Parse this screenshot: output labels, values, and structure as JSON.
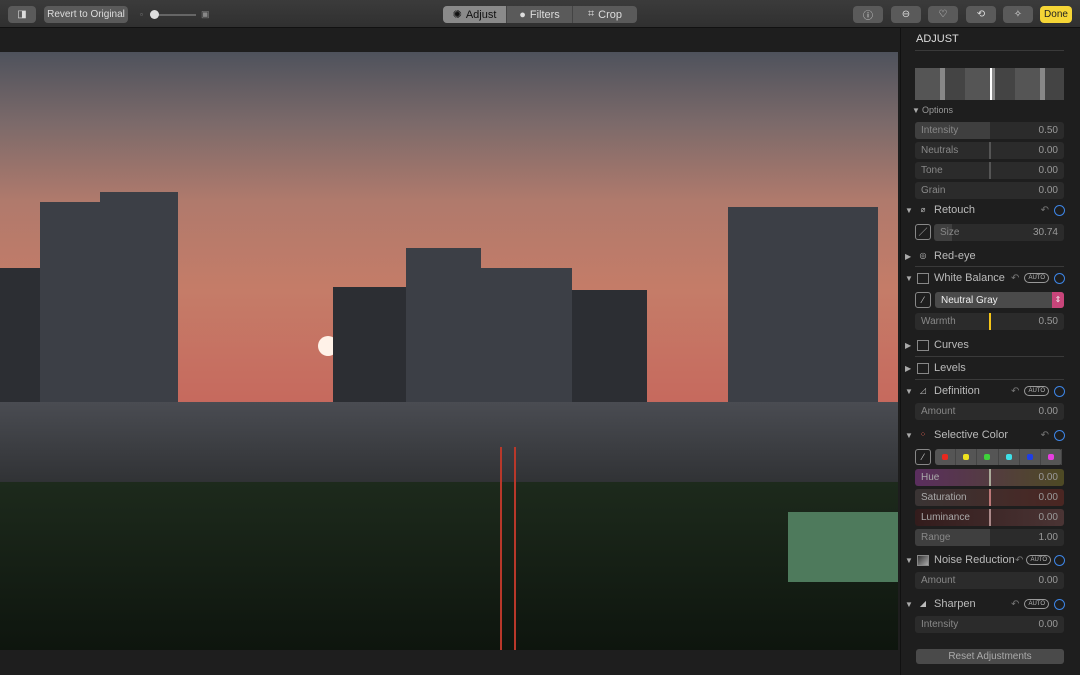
{
  "toolbar": {
    "revert": "Revert to Original",
    "tabs": [
      "Adjust",
      "Filters",
      "Crop"
    ],
    "active_tab": "Adjust",
    "done": "Done",
    "icons": [
      "info-icon",
      "more-icon",
      "heart-icon",
      "rotate-icon",
      "magic-wand-icon"
    ]
  },
  "sidebar": {
    "title": "ADJUST",
    "options_label": "Options",
    "options": [
      {
        "label": "Intensity",
        "value": "0.50",
        "fraction": 0.5
      },
      {
        "label": "Neutrals",
        "value": "0.00"
      },
      {
        "label": "Tone",
        "value": "0.00"
      },
      {
        "label": "Grain",
        "value": "0.00"
      }
    ],
    "retouch": {
      "label": "Retouch",
      "size_label": "Size",
      "size_value": "30.74"
    },
    "redeye": {
      "label": "Red-eye"
    },
    "white_balance": {
      "label": "White Balance",
      "auto": "AUTO",
      "mode": "Neutral Gray",
      "warmth_label": "Warmth",
      "warmth_value": "0.50"
    },
    "curves": {
      "label": "Curves"
    },
    "levels": {
      "label": "Levels"
    },
    "definition": {
      "label": "Definition",
      "auto": "AUTO",
      "amount_label": "Amount",
      "amount_value": "0.00"
    },
    "selective_color": {
      "label": "Selective Color",
      "swatches": [
        "#e8281e",
        "#eee21e",
        "#3ed23a",
        "#3ee0e8",
        "#1e3ee6",
        "#e83ee0"
      ],
      "rows": [
        {
          "label": "Hue",
          "value": "0.00"
        },
        {
          "label": "Saturation",
          "value": "0.00"
        },
        {
          "label": "Luminance",
          "value": "0.00"
        },
        {
          "label": "Range",
          "value": "1.00"
        }
      ]
    },
    "noise_reduction": {
      "label": "Noise Reduction",
      "auto": "AUTO",
      "amount_label": "Amount",
      "amount_value": "0.00"
    },
    "sharpen": {
      "label": "Sharpen",
      "auto": "AUTO",
      "intensity_label": "Intensity",
      "intensity_value": "0.00"
    },
    "reset": "Reset Adjustments"
  },
  "colors": {
    "accent": "#3d85e6",
    "done": "#f5d536",
    "warmth_marker": "#f5c518"
  }
}
